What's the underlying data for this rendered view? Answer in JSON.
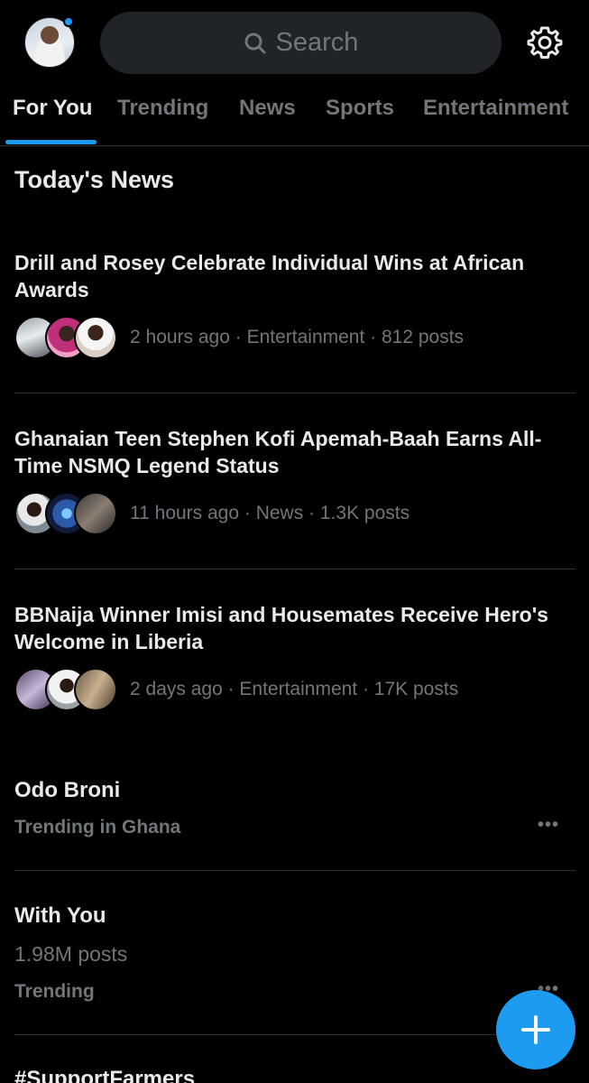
{
  "header": {
    "search_placeholder": "Search",
    "icons": [
      "avatar",
      "search-icon",
      "gear-icon"
    ]
  },
  "tabs": [
    {
      "label": "For You",
      "active": true
    },
    {
      "label": "Trending",
      "active": false
    },
    {
      "label": "News",
      "active": false
    },
    {
      "label": "Sports",
      "active": false
    },
    {
      "label": "Entertainment",
      "active": false
    }
  ],
  "section_title": "Today's News",
  "news": [
    {
      "headline": "Drill and Rosey Celebrate Individual Wins at African Awards",
      "meta": "2 hours ago · Entertainment · 812 posts"
    },
    {
      "headline": "Ghanaian Teen Stephen Kofi Apemah-Baah Earns All-Time NSMQ Legend Status",
      "meta": "11 hours ago · News · 1.3K posts"
    },
    {
      "headline": "BBNaija Winner Imisi and Housemates Receive Hero's Welcome in Liberia",
      "meta": "2 days ago · Entertainment · 17K posts"
    }
  ],
  "trends": [
    {
      "title": "Odo Broni",
      "context": "Trending in Ghana"
    },
    {
      "title": "With You",
      "count": "1.98M posts",
      "context": "Trending"
    },
    {
      "title": "#SupportFarmers"
    }
  ],
  "colors": {
    "accent": "#1d9bf0",
    "background": "#000000",
    "text_primary": "#e7e9ea",
    "text_secondary": "#71767b",
    "divider": "#2f3336"
  }
}
